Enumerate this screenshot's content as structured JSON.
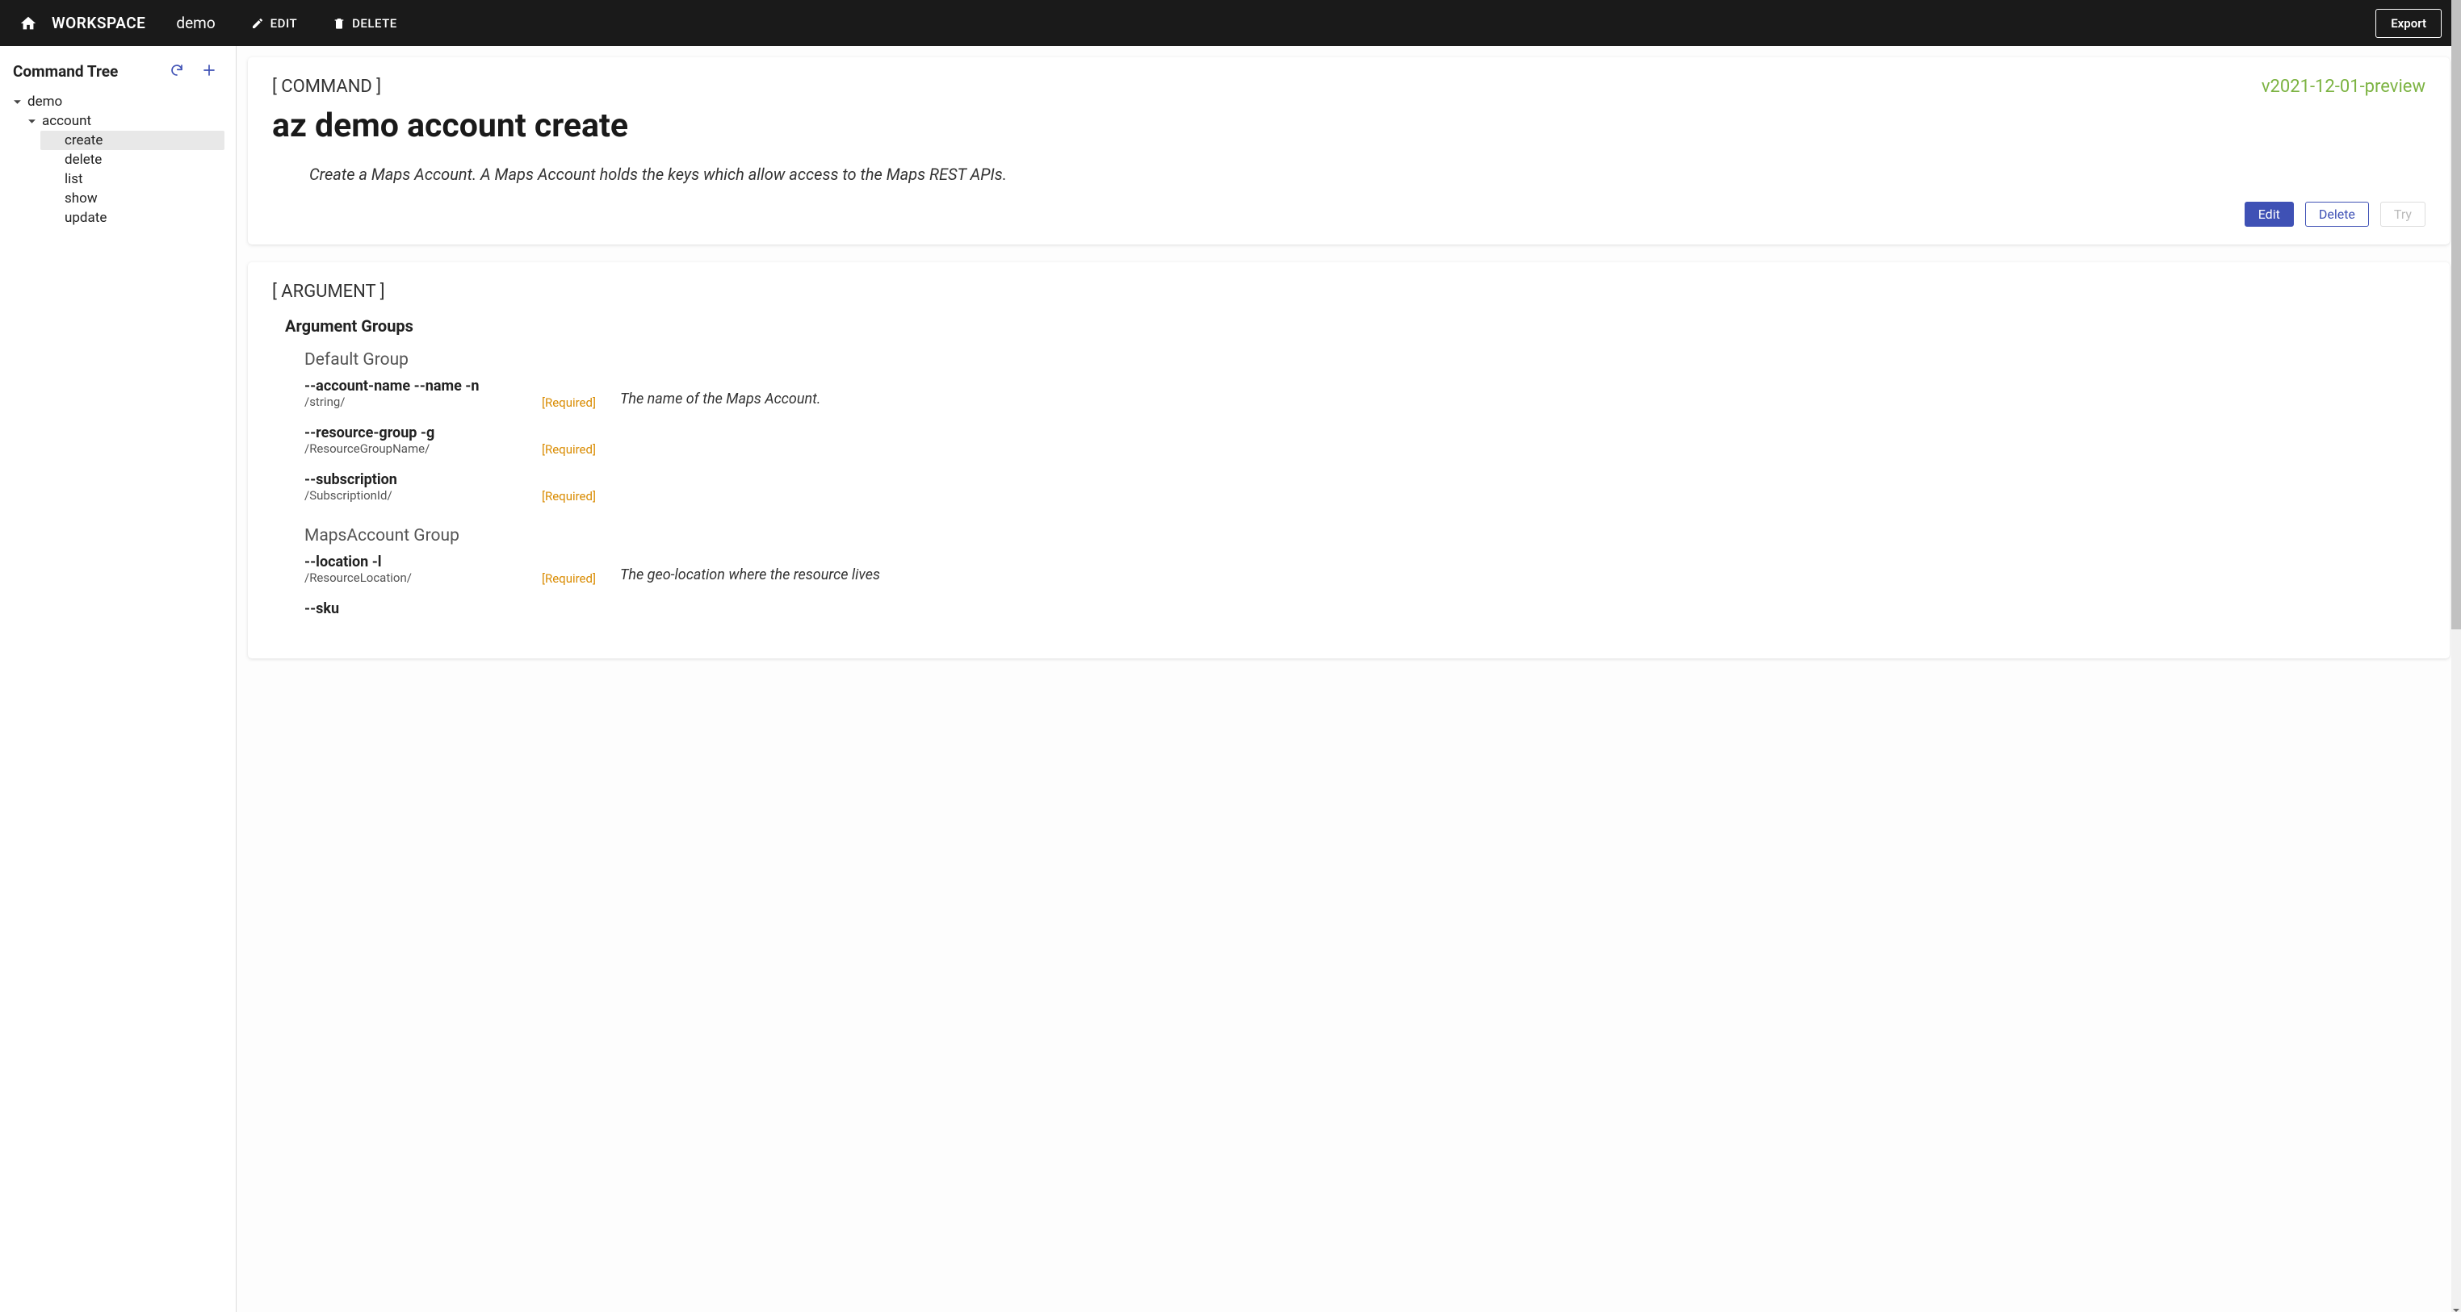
{
  "topbar": {
    "workspace_label": "WORKSPACE",
    "workspace_name": "demo",
    "edit_label": "EDIT",
    "delete_label": "DELETE",
    "export_label": "Export"
  },
  "sidebar": {
    "title": "Command Tree",
    "tree": {
      "root": "demo",
      "group": "account",
      "items": [
        {
          "label": "create",
          "selected": true
        },
        {
          "label": "delete",
          "selected": false
        },
        {
          "label": "list",
          "selected": false
        },
        {
          "label": "show",
          "selected": false
        },
        {
          "label": "update",
          "selected": false
        }
      ]
    }
  },
  "command": {
    "section_label": "[ COMMAND ]",
    "version": "v2021-12-01-preview",
    "title": "az demo account create",
    "description": "Create a Maps Account. A Maps Account holds the keys which allow access to the Maps REST APIs.",
    "edit_label": "Edit",
    "delete_label": "Delete",
    "try_label": "Try"
  },
  "argument": {
    "section_label": "[ ARGUMENT ]",
    "groups_title": "Argument Groups",
    "required_badge": "[Required]",
    "groups": [
      {
        "name": "Default Group",
        "args": [
          {
            "name": "--account-name --name -n",
            "type": "/string/",
            "required": true,
            "desc": "The name of the Maps Account."
          },
          {
            "name": "--resource-group -g",
            "type": "/ResourceGroupName/",
            "required": true,
            "desc": ""
          },
          {
            "name": "--subscription",
            "type": "/SubscriptionId/",
            "required": true,
            "desc": ""
          }
        ]
      },
      {
        "name": "MapsAccount Group",
        "args": [
          {
            "name": "--location -l",
            "type": "/ResourceLocation/",
            "required": true,
            "desc": "The geo-location where the resource lives"
          },
          {
            "name": "--sku",
            "type": "",
            "required": false,
            "desc": ""
          }
        ]
      }
    ]
  }
}
